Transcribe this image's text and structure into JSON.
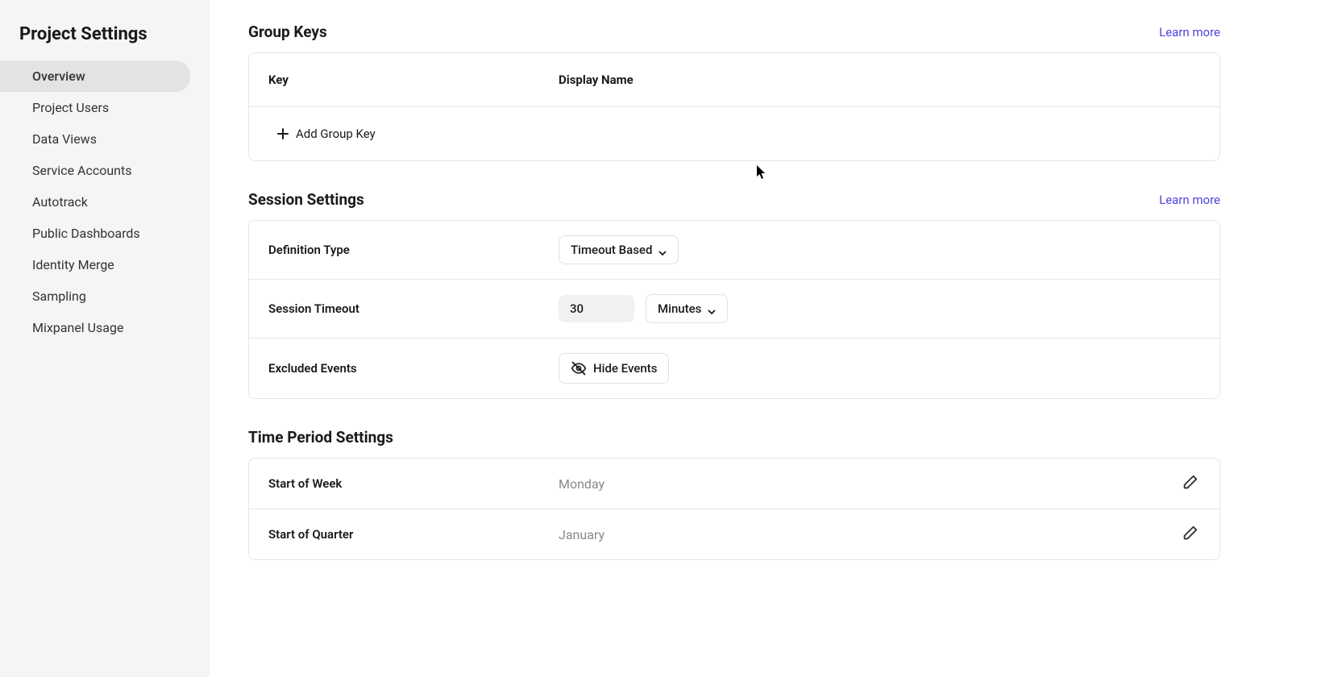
{
  "sidebar": {
    "title": "Project Settings",
    "items": [
      {
        "label": "Overview",
        "active": true
      },
      {
        "label": "Project Users",
        "active": false
      },
      {
        "label": "Data Views",
        "active": false
      },
      {
        "label": "Service Accounts",
        "active": false
      },
      {
        "label": "Autotrack",
        "active": false
      },
      {
        "label": "Public Dashboards",
        "active": false
      },
      {
        "label": "Identity Merge",
        "active": false
      },
      {
        "label": "Sampling",
        "active": false
      },
      {
        "label": "Mixpanel Usage",
        "active": false
      }
    ]
  },
  "group_keys": {
    "title": "Group Keys",
    "learn_more": "Learn more",
    "columns": {
      "key": "Key",
      "display_name": "Display Name"
    },
    "add_button": "Add Group Key"
  },
  "session_settings": {
    "title": "Session Settings",
    "learn_more": "Learn more",
    "rows": {
      "definition_type": {
        "label": "Definition Type",
        "value": "Timeout Based"
      },
      "session_timeout": {
        "label": "Session Timeout",
        "value": "30",
        "unit": "Minutes"
      },
      "excluded_events": {
        "label": "Excluded Events",
        "button": "Hide Events"
      }
    }
  },
  "time_period_settings": {
    "title": "Time Period Settings",
    "rows": {
      "start_of_week": {
        "label": "Start of Week",
        "value": "Monday"
      },
      "start_of_quarter": {
        "label": "Start of Quarter",
        "value": "January"
      }
    }
  }
}
